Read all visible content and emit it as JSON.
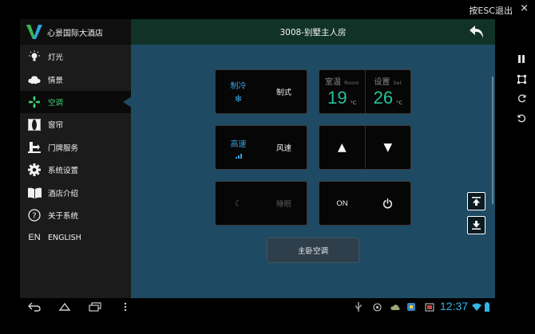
{
  "overlay": {
    "esc_hint": "按ESC退出",
    "close_symbol": "×"
  },
  "brand": {
    "name": "心景国际大酒店"
  },
  "header": {
    "title": "3008-别墅主人房"
  },
  "sidebar": {
    "items": [
      {
        "label": "灯光",
        "icon": "light-bulb-icon"
      },
      {
        "label": "情景",
        "icon": "scene-clouds-icon"
      },
      {
        "label": "空调",
        "icon": "fan-icon",
        "active": true
      },
      {
        "label": "窗帘",
        "icon": "curtain-icon"
      },
      {
        "label": "门牌服务",
        "icon": "doorplate-service-icon"
      },
      {
        "label": "系统设置",
        "icon": "gear-icon"
      },
      {
        "label": "酒店介绍",
        "icon": "book-icon"
      },
      {
        "label": "关于系统",
        "icon": "question-circle-icon"
      },
      {
        "label": "ENGLISH",
        "icon": "english-text-icon",
        "icon_text": "EN"
      }
    ]
  },
  "ac": {
    "mode_value": "制冷",
    "mode_label": "制式",
    "room_temp_title": "室温",
    "room_temp_en": "Room",
    "room_temp_value": "19",
    "set_temp_title": "设置",
    "set_temp_en": "Set",
    "set_temp_value": "26",
    "temp_unit": "°C",
    "fan_value": "高速",
    "fan_label": "风速",
    "fan_level": 1.0,
    "sleep_label": "睡眠",
    "power_label": "ON",
    "room_button": "主卧空调"
  },
  "status_bar": {
    "time": "12:37"
  },
  "colors": {
    "accent_blue": "#3aa3e0",
    "temp_green": "#22c39a",
    "active_green": "#3ed37a",
    "panel_bg": "#1f4a63"
  }
}
